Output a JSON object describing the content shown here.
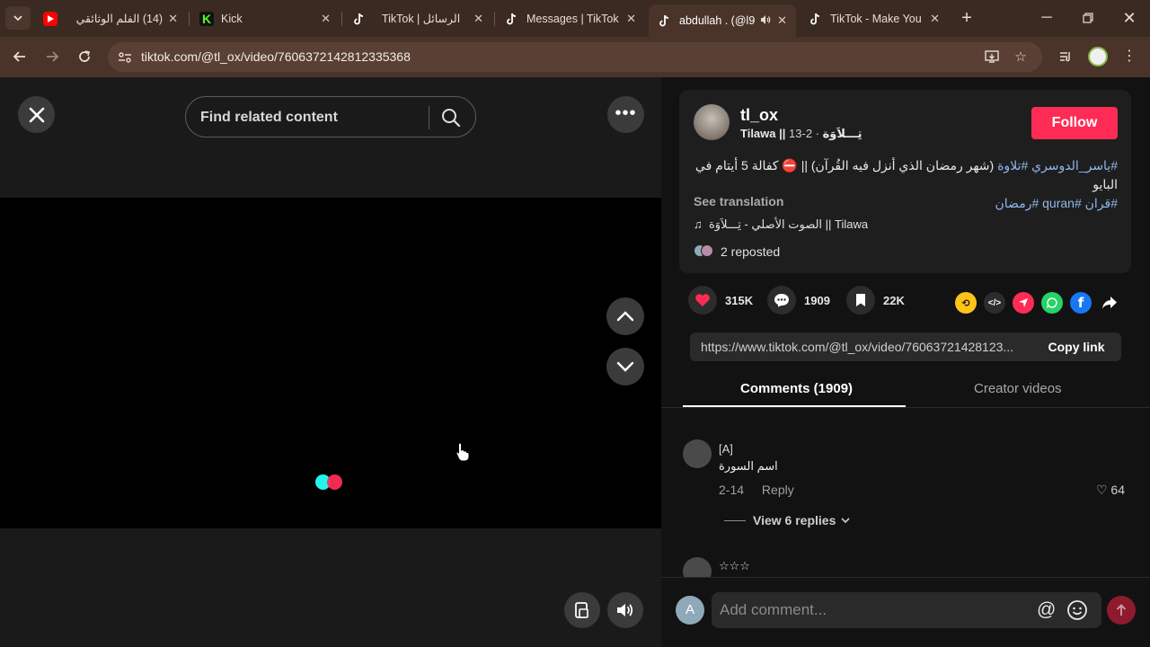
{
  "browser": {
    "tabs": [
      {
        "title": "(14) الفلم الوثائقي",
        "favicon": "youtube-icon",
        "color": "#ff0000"
      },
      {
        "title": "Kick",
        "favicon": "kick-icon",
        "color": "#53fc18"
      },
      {
        "title": "TikTok | الرسائل",
        "favicon": "tiktok-icon"
      },
      {
        "title": "Messages | TikTok",
        "favicon": "tiktok-icon"
      },
      {
        "title": "abdullah . (@l9",
        "favicon": "tiktok-icon",
        "active": true
      },
      {
        "title": "TikTok - Make You",
        "favicon": "tiktok-icon"
      }
    ],
    "url": "tiktok.com/@tl_ox/video/7606372142812335368"
  },
  "video": {
    "search_placeholder": "Find related content",
    "loader_colors": [
      "#25f4ee",
      "#fe2c55"
    ]
  },
  "post": {
    "username": "tl_ox",
    "display_name": "Tilawa || تِـــلاَوَة",
    "date": "2-13",
    "follow_label": "Follow",
    "description_text": "(شهر رمضان الذي أنزل فيه القُرآن) || ⛔ كفالة 5 أيتام في البايو",
    "hashtags_line1": [
      "#تلاوة",
      "#ياسر_الدوسري"
    ],
    "hashtags_line2": [
      "#رمضان",
      "#quran",
      "#قران"
    ],
    "see_translation": "See translation",
    "music": "الصوت الأصلي - تِـــلاَوَة || Tilawa",
    "reposted": "2 reposted",
    "likes": "315K",
    "comments": "1909",
    "saves": "22K",
    "link": "https://www.tiktok.com/@tl_ox/video/76063721428123...",
    "copy_link": "Copy link",
    "accent": "#fe2c55"
  },
  "panel_tabs": {
    "comments": "Comments (1909)",
    "creator_videos": "Creator videos"
  },
  "comments": [
    {
      "name": "[A]",
      "text": "اسم السورة",
      "date": "2-14",
      "reply": "Reply",
      "likes": "64",
      "replies": "View 6 replies"
    },
    {
      "name": "☆☆☆"
    }
  ],
  "comment_bar": {
    "avatar_letter": "A",
    "placeholder": "Add comment..."
  }
}
